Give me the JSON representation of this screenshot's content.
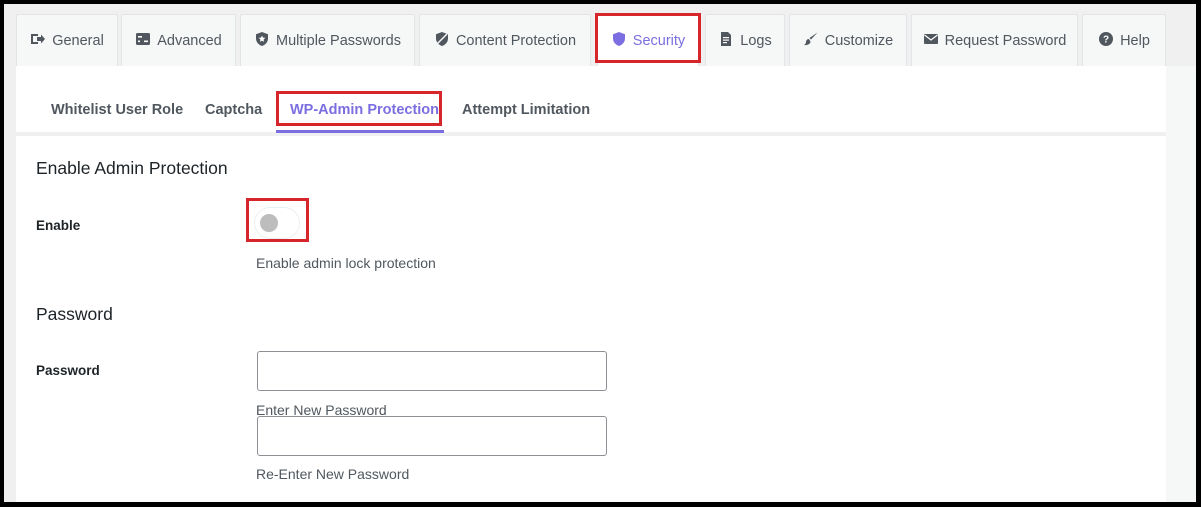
{
  "tabs": [
    {
      "label": "General",
      "icon": "sign-in-icon"
    },
    {
      "label": "Advanced",
      "icon": "sliders-icon"
    },
    {
      "label": "Multiple Passwords",
      "icon": "shield-star-icon"
    },
    {
      "label": "Content Protection",
      "icon": "shield-slash-icon"
    },
    {
      "label": "Security",
      "icon": "shield-icon",
      "active": true
    },
    {
      "label": "Logs",
      "icon": "document-icon"
    },
    {
      "label": "Customize",
      "icon": "brush-icon"
    },
    {
      "label": "Request Password",
      "icon": "envelope-icon"
    },
    {
      "label": "Help",
      "icon": "question-icon"
    }
  ],
  "subtabs": [
    {
      "label": "Whitelist User Role"
    },
    {
      "label": "Captcha"
    },
    {
      "label": "WP-Admin Protection",
      "active": true
    },
    {
      "label": "Attempt Limitation"
    }
  ],
  "sections": {
    "admin_protection": {
      "title": "Enable Admin Protection",
      "enable_label": "Enable",
      "toggle_on": false,
      "description": "Enable admin lock protection"
    },
    "password": {
      "title": "Password",
      "field_label": "Password",
      "new_value": "",
      "new_help": "Enter New Password",
      "reenter_value": "",
      "reenter_help": "Re-Enter New Password"
    }
  },
  "colors": {
    "accent": "#7b6ee0",
    "highlight": "#d6262b",
    "background": "#f0f0f1"
  }
}
